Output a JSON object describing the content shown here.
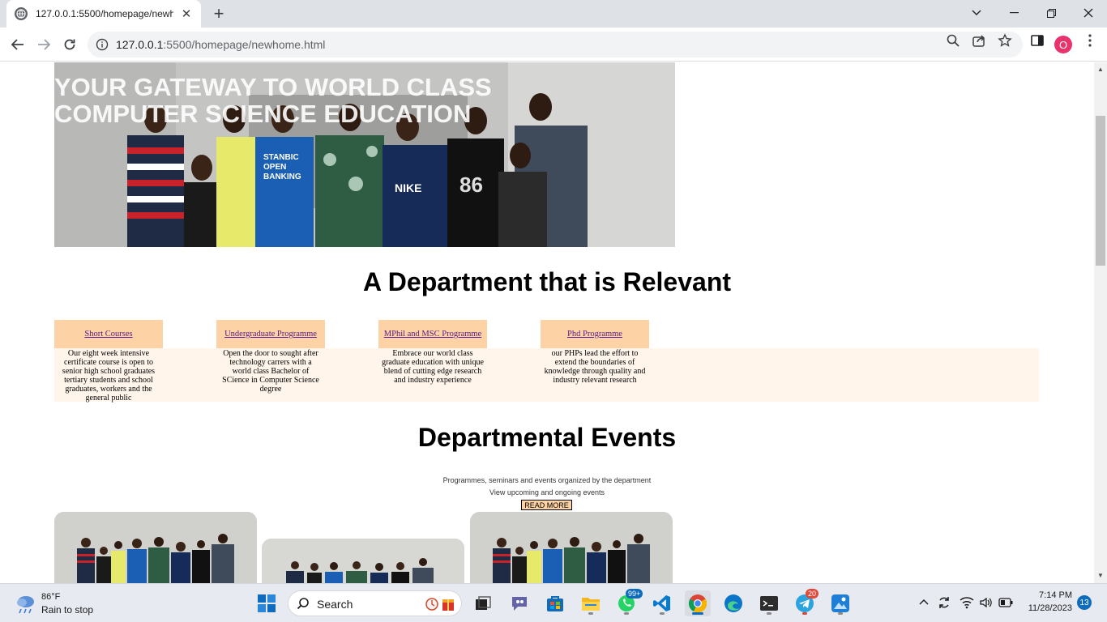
{
  "browser": {
    "tab_title": "127.0.0.1:5500/homepage/newh",
    "url_host": "127.0.0.1",
    "url_path": ":5500/homepage/newhome.html",
    "profile_initial": "O"
  },
  "hero": {
    "title_line1": "YOUR GATEWAY TO WORLD CLASS",
    "title_line2": "COMPUTER SCIENCE EDUCATION"
  },
  "relevant_section": {
    "heading": "A Department that is Relevant",
    "programs": [
      {
        "title": "Short Courses",
        "description": "Our eight week intensive certificate course is open to senior high school graduates tertiary students and school graduates, workers and the general public"
      },
      {
        "title": "Undergraduate Programme",
        "description": "Open the door to sought after technology carrers with a world class Bachelor of SCience in Computer Science degree"
      },
      {
        "title": "MPhil and MSC Programme",
        "description": "Embrace our world class graduate education with unique blend of cutting edge research and industry experience"
      },
      {
        "title": "Phd Programme",
        "description": "our PHPs lead the effort to extend the boundaries of knowledge through quality and industry relevant research"
      }
    ]
  },
  "events_section": {
    "heading": "Departmental Events",
    "subtitle_1": "Programmes, seminars and events organized by the department",
    "subtitle_2": "View upcoming and ongoing events",
    "read_more": "READ MORE"
  },
  "photo_shirts": [
    "STANBIC",
    "OPEN",
    "BANKING",
    "NIKE",
    "86"
  ],
  "taskbar": {
    "weather_temp": "86°F",
    "weather_cond": "Rain to stop",
    "search_label": "Search",
    "whatsapp_badge": "99+",
    "telegram_badge": "20",
    "time": "7:14 PM",
    "date": "11/28/2023",
    "notifications": "13"
  },
  "colors": {
    "program_header": "#fdd2a4",
    "program_band": "#fff5eb",
    "link": "#551a8b"
  }
}
